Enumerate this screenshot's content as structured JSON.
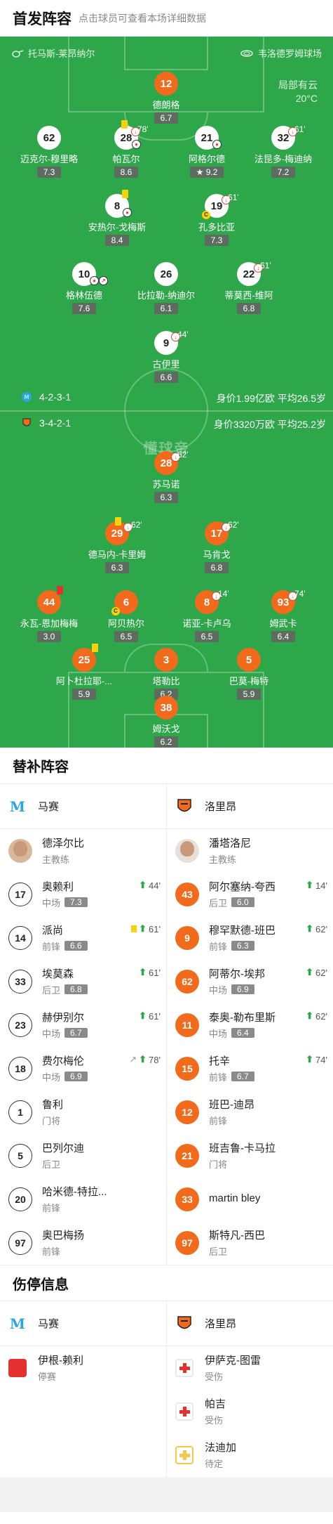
{
  "header": {
    "title": "首发阵容",
    "subtitle": "点击球员可查看本场详细数据"
  },
  "pitch": {
    "home_team": "托马斯-莱昂纳尔",
    "venue": "韦洛德罗姆球场",
    "weather": "局部有云",
    "temperature": "20°C",
    "watermark": "懂球帝",
    "home_formation": "4-2-3-1",
    "home_value": "身价1.99亿欧  平均26.5岁",
    "away_formation": "3-4-2-1",
    "away_value": "身价3320万欧  平均25.2岁",
    "home_players": [
      {
        "num": "12",
        "name": "德朗格",
        "rating": "6.7"
      },
      {
        "num": "62",
        "name": "迈克尔-穆里略",
        "rating": "7.3"
      },
      {
        "num": "28",
        "name": "帕瓦尔",
        "rating": "8.6",
        "sub": "78'"
      },
      {
        "num": "21",
        "name": "阿格尔德",
        "rating": "9.2"
      },
      {
        "num": "32",
        "name": "法昆多-梅迪纳",
        "rating": "7.2",
        "sub": "61'"
      },
      {
        "num": "8",
        "name": "安热尔-戈梅斯",
        "rating": "8.4"
      },
      {
        "num": "19",
        "name": "孔多比亚",
        "rating": "7.3",
        "sub": "61'"
      },
      {
        "num": "10",
        "name": "格林伍德",
        "rating": "7.6"
      },
      {
        "num": "26",
        "name": "比拉勒-纳迪尔",
        "rating": "6.1"
      },
      {
        "num": "22",
        "name": "蒂莫西-维阿",
        "rating": "6.8",
        "sub": "61'"
      },
      {
        "num": "9",
        "name": "古伊里",
        "rating": "6.6",
        "sub": "44'"
      }
    ],
    "away_players": [
      {
        "num": "28",
        "name": "苏马诺",
        "rating": "6.3",
        "sub": "62'"
      },
      {
        "num": "29",
        "name": "德马内-卡里姆",
        "rating": "6.3",
        "sub": "62'"
      },
      {
        "num": "17",
        "name": "马肯戈",
        "rating": "6.8",
        "sub": "62'"
      },
      {
        "num": "44",
        "name": "永瓦-恩加梅梅",
        "rating": "3.0"
      },
      {
        "num": "6",
        "name": "阿贝热尔",
        "rating": "6.5"
      },
      {
        "num": "8",
        "name": "诺亚-卡卢乌",
        "rating": "6.5",
        "sub": "14'"
      },
      {
        "num": "93",
        "name": "姆武卡",
        "rating": "6.4",
        "sub": "74'"
      },
      {
        "num": "25",
        "name": "阿卜杜拉耶-...",
        "rating": "5.9"
      },
      {
        "num": "3",
        "name": "塔勒比",
        "rating": "6.2"
      },
      {
        "num": "5",
        "name": "巴莫-梅特",
        "rating": "5.9"
      },
      {
        "num": "38",
        "name": "姆沃戈",
        "rating": "6.2"
      }
    ]
  },
  "subs": {
    "title": "替补阵容",
    "home_team": "马赛",
    "away_team": "洛里昂",
    "home_coach": {
      "name": "德泽尔比",
      "role": "主教练"
    },
    "away_coach": {
      "name": "潘塔洛尼",
      "role": "主教练"
    },
    "home": [
      {
        "num": "17",
        "name": "奥赖利",
        "pos": "中场",
        "rating": "7.3",
        "evt": "44'"
      },
      {
        "num": "14",
        "name": "派尚",
        "pos": "前锋",
        "rating": "6.6",
        "evt": "61'"
      },
      {
        "num": "33",
        "name": "埃莫森",
        "pos": "后卫",
        "rating": "6.8",
        "evt": "61'"
      },
      {
        "num": "23",
        "name": "赫伊别尔",
        "pos": "中场",
        "rating": "6.7",
        "evt": "61'"
      },
      {
        "num": "18",
        "name": "费尔梅伦",
        "pos": "中场",
        "rating": "6.9",
        "evt": "78'"
      },
      {
        "num": "1",
        "name": "鲁利",
        "pos": "门将",
        "rating": "",
        "evt": ""
      },
      {
        "num": "5",
        "name": "巴列尔迪",
        "pos": "后卫",
        "rating": "",
        "evt": ""
      },
      {
        "num": "20",
        "name": "哈米德-特拉...",
        "pos": "前锋",
        "rating": "",
        "evt": ""
      },
      {
        "num": "97",
        "name": "奥巴梅扬",
        "pos": "前锋",
        "rating": "",
        "evt": ""
      }
    ],
    "away": [
      {
        "num": "43",
        "name": "阿尔塞纳-夸西",
        "pos": "后卫",
        "rating": "6.0",
        "evt": "14'"
      },
      {
        "num": "9",
        "name": "穆罕默德-班巴",
        "pos": "前锋",
        "rating": "6.3",
        "evt": "62'"
      },
      {
        "num": "62",
        "name": "阿蒂尔-埃邦",
        "pos": "中场",
        "rating": "6.9",
        "evt": "62'"
      },
      {
        "num": "11",
        "name": "泰奥-勒布里斯",
        "pos": "中场",
        "rating": "6.4",
        "evt": "62'"
      },
      {
        "num": "15",
        "name": "托辛",
        "pos": "前锋",
        "rating": "6.7",
        "evt": "74'"
      },
      {
        "num": "12",
        "name": "班巴-迪昂",
        "pos": "前锋",
        "rating": "",
        "evt": ""
      },
      {
        "num": "21",
        "name": "班吉鲁-卡马拉",
        "pos": "门将",
        "rating": "",
        "evt": ""
      },
      {
        "num": "33",
        "name": "martin bley",
        "pos": "",
        "rating": "",
        "evt": ""
      },
      {
        "num": "97",
        "name": "斯特凡-西巴",
        "pos": "后卫",
        "rating": "",
        "evt": ""
      }
    ]
  },
  "injuries": {
    "title": "伤停信息",
    "home_team": "马赛",
    "away_team": "洛里昂",
    "home": [
      {
        "name": "伊根-赖利",
        "status": "停赛"
      }
    ],
    "away": [
      {
        "name": "伊萨克-图雷",
        "status": "受伤"
      },
      {
        "name": "帕吉",
        "status": "受伤"
      },
      {
        "name": "法迪加",
        "status": "待定"
      }
    ]
  },
  "colors": {
    "pitch": "#2ea64a",
    "away": "#f26a1b",
    "sub_up": "#2ea64a",
    "card_red": "#e53030",
    "card_yellow": "#f5d20a"
  }
}
